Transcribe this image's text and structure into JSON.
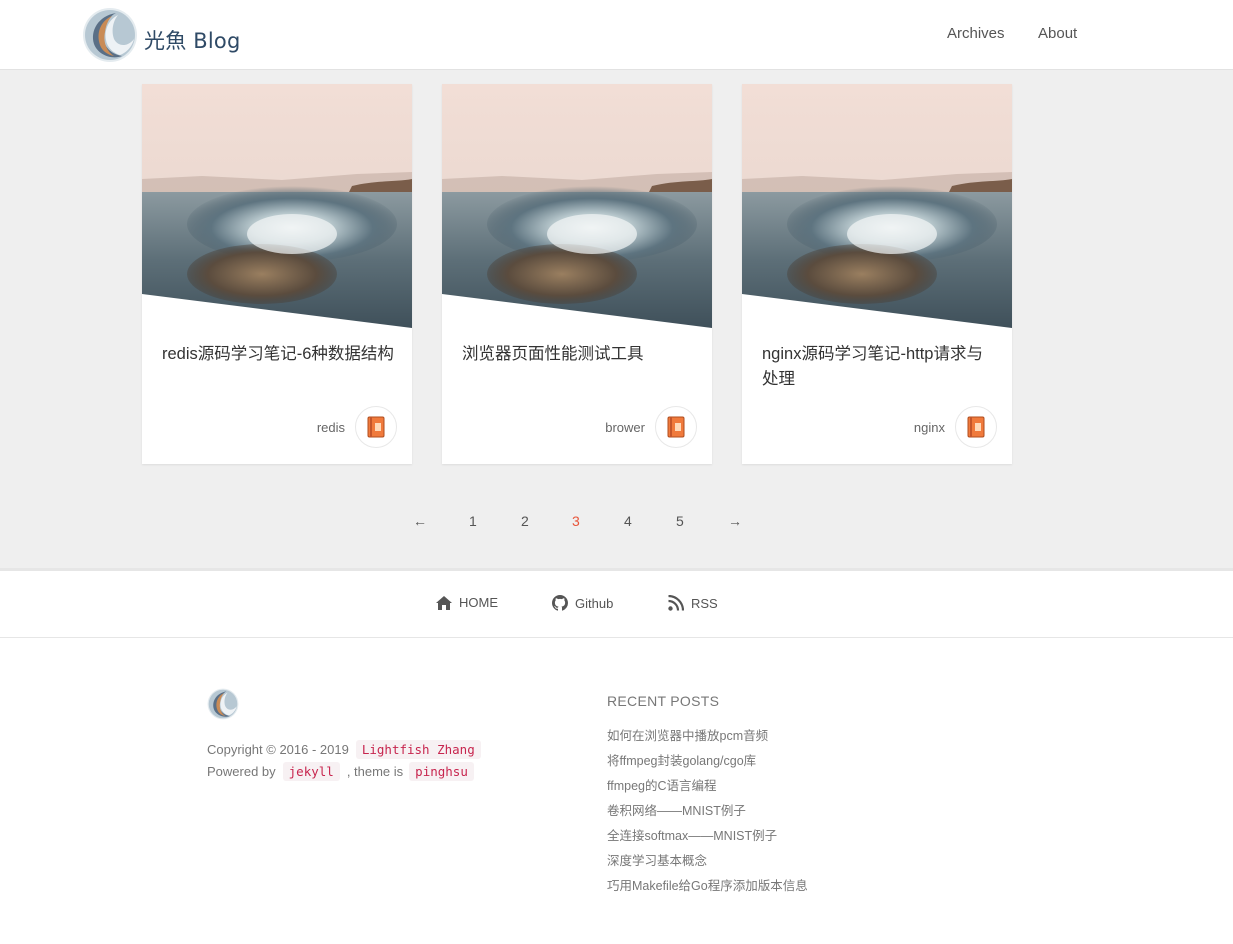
{
  "header": {
    "brand_title": "光魚 Blog",
    "nav": [
      {
        "label": "Archives"
      },
      {
        "label": "About"
      }
    ]
  },
  "posts": [
    {
      "title": "redis源码学习笔记-6种数据结构",
      "tag": "redis",
      "badge_icon": "notebook-icon"
    },
    {
      "title": "浏览器页面性能测试工具",
      "tag": "brower",
      "badge_icon": "notebook-icon"
    },
    {
      "title": "nginx源码学习笔记-http请求与处理",
      "tag": "nginx",
      "badge_icon": "notebook-icon"
    }
  ],
  "pagination": {
    "prev": "←",
    "pages": [
      "1",
      "2",
      "3",
      "4",
      "5"
    ],
    "current": "3",
    "next": "→"
  },
  "footer_nav": {
    "home": "HOME",
    "github": "Github",
    "rss": "RSS"
  },
  "footer": {
    "copyright_text": "Copyright © 2016 - 2019",
    "author": "Lightfish Zhang",
    "powered_by": "Powered by",
    "engine": "jekyll",
    "theme_text": ", theme is",
    "theme": "pinghsu",
    "recent_title": "RECENT POSTS",
    "recent_posts": [
      "如何在浏览器中播放pcm音频",
      "将ffmpeg封装golang/cgo库",
      "ffmpeg的C语言编程",
      "卷积网络——MNIST例子",
      "全连接softmax——MNIST例子",
      "深度学习基本概念",
      "巧用Makefile给Go程序添加版本信息"
    ]
  },
  "colors": {
    "accent": "#e8553a",
    "brand_text": "#2f4a66",
    "code_text": "#c7254e"
  }
}
